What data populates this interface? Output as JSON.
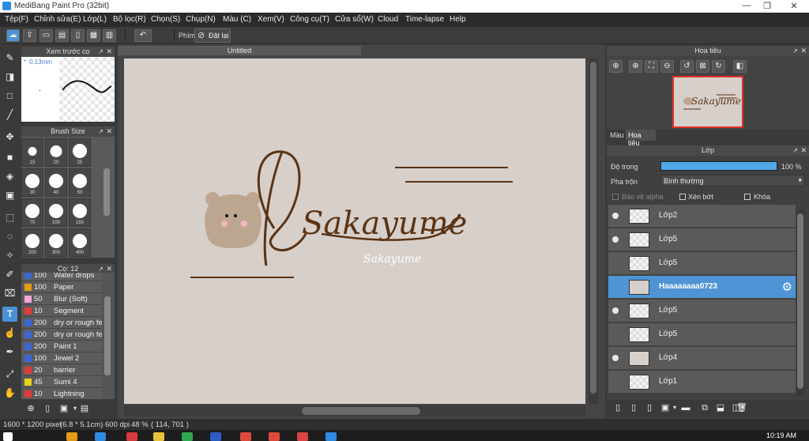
{
  "window": {
    "title": "MediBang Paint Pro (32bit)",
    "minimize": "—",
    "restore": "❐",
    "close": "✕"
  },
  "menu": [
    "Tệp(F)",
    "Chỉnh sửa(E)",
    "Lớp(L)",
    "Bộ lọc(R)",
    "Chọn(S)",
    "Chụp(N)",
    "Màu (C)",
    "Xem(V)",
    "Công cụ(T)",
    "Cửa sổ(W)",
    "Cloud",
    "Time-lapse",
    "Help"
  ],
  "toolbar": {
    "shortcut_label": "Phím",
    "reset_label": "Đặt lại"
  },
  "preview_panel": {
    "title": "Xem trước cọ",
    "size_text": "0.13mm"
  },
  "brush_size_panel": {
    "title": "Brush Size",
    "sizes": [
      "15",
      "20",
      "25",
      "30",
      "40",
      "50",
      "70",
      "100",
      "150",
      "200",
      "300",
      "400"
    ]
  },
  "brush_panel": {
    "title": "Cọ: 12",
    "brushes": [
      {
        "size": "100",
        "name": "Water drops",
        "color": "#3d66d6"
      },
      {
        "size": "100",
        "name": "Paper",
        "color": "#e39a15"
      },
      {
        "size": "50",
        "name": "Blur (Soft)",
        "color": "#f4a6d8"
      },
      {
        "size": "10",
        "name": "Segment",
        "color": "#e23b3b"
      },
      {
        "size": "200",
        "name": "dry or rough fe",
        "color": "#3d66d6"
      },
      {
        "size": "200",
        "name": "dry or rough fe",
        "color": "#3d66d6"
      },
      {
        "size": "200",
        "name": "Paint 1",
        "color": "#3d66d6"
      },
      {
        "size": "100",
        "name": "Jewel 2",
        "color": "#3d66d6"
      },
      {
        "size": "20",
        "name": "barrier",
        "color": "#e23b3b"
      },
      {
        "size": "45",
        "name": "Sumi 4",
        "color": "#e8d11a"
      },
      {
        "size": "10",
        "name": "Lightning",
        "color": "#e23b3b"
      }
    ]
  },
  "document": {
    "tab_title": "Untitled",
    "logo_text": "Sakayume",
    "logo_small_text": "Sakayume"
  },
  "navigator_panel": {
    "title": "Hoa tiêu"
  },
  "nav_tabs": [
    "Màu",
    "Hoa tiêu"
  ],
  "layer_panel": {
    "title": "Lớp",
    "opacity_label": "Độ trong",
    "opacity_value": "100 %",
    "opacity_percent": 100,
    "blend_label": "Pha trộn",
    "blend_value": "Bình thường",
    "protect_alpha": "Bảo vệ alpha",
    "clipping": "Xén bớt",
    "lock": "Khóa",
    "layers": [
      {
        "name": "Lớp2",
        "visible": true,
        "selected": false
      },
      {
        "name": "Lớp5",
        "visible": true,
        "selected": false
      },
      {
        "name": "Lớp5",
        "visible": false,
        "selected": false
      },
      {
        "name": "Haaaaaaaa0723",
        "visible": false,
        "selected": true
      },
      {
        "name": "Lớp5",
        "visible": true,
        "selected": false
      },
      {
        "name": "Lớp5",
        "visible": false,
        "selected": false
      },
      {
        "name": "Lớp4",
        "visible": true,
        "selected": false
      },
      {
        "name": "Lớp1",
        "visible": false,
        "selected": false
      }
    ]
  },
  "status": {
    "dims": "1600 * 1200 pixel",
    "size_cm": "(6.8 * 5.1cm)",
    "dpi": "600 dpi",
    "zoom": "48 %",
    "coords": "( 114, 701 )"
  },
  "taskbar": {
    "clock": "10:19 AM"
  },
  "colors": {
    "accent": "#4f94d4",
    "canvas_bg": "#d7cfca",
    "ink": "#5a3414",
    "bear": "#bda690",
    "nav_border": "#e0302a"
  }
}
